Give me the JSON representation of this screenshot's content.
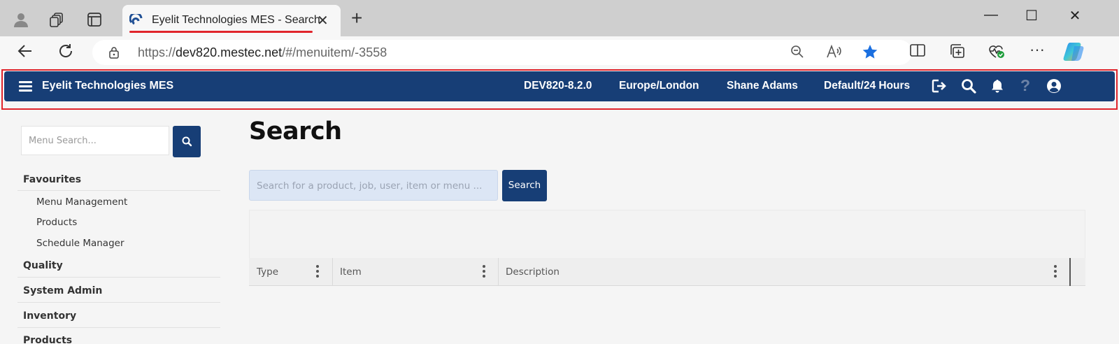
{
  "browser": {
    "tab_title": "Eyelit Technologies MES - Search",
    "url_scheme": "https://",
    "url_host": "dev820.mestec.net",
    "url_path": "/#/menuitem/-3558"
  },
  "navbar": {
    "brand": "Eyelit Technologies MES",
    "version": "DEV820-8.2.0",
    "timezone": "Europe/London",
    "user": "Shane Adams",
    "shift": "Default/24 Hours",
    "icons": [
      "logout-icon",
      "search-icon",
      "bell-icon",
      "help-icon",
      "user-circle-icon"
    ],
    "bg_color": "#173e76"
  },
  "sidebar": {
    "search_placeholder": "Menu Search...",
    "sections": [
      {
        "label": "Favourites",
        "items": [
          "Menu Management",
          "Products",
          "Schedule Manager"
        ]
      },
      {
        "label": "Quality"
      },
      {
        "label": "System Admin"
      },
      {
        "label": "Inventory"
      },
      {
        "label": "Products"
      }
    ]
  },
  "main": {
    "title": "Search",
    "search_placeholder": "Search for a product, job, user, item or menu ...",
    "search_button": "Search",
    "columns": [
      "Type",
      "Item",
      "Description"
    ]
  }
}
